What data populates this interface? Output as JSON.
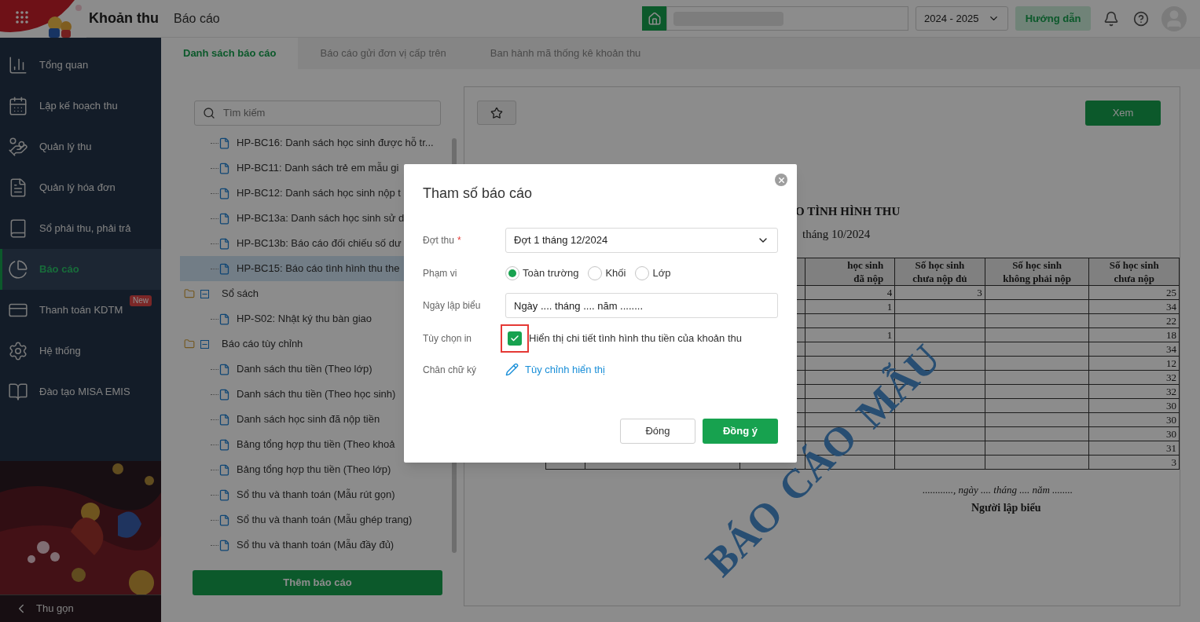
{
  "header": {
    "module": "Khoản thu",
    "page": "Báo cáo",
    "year": "2024 - 2025",
    "help_button": "Hướng dẫn"
  },
  "sidebar": {
    "items": [
      {
        "label": "Tổng quan",
        "selected": false
      },
      {
        "label": "Lập kế hoạch thu",
        "selected": false
      },
      {
        "label": "Quản lý thu",
        "selected": false
      },
      {
        "label": "Quản lý hóa đơn",
        "selected": false
      },
      {
        "label": "Sổ phải thu, phải trả",
        "selected": false
      },
      {
        "label": "Báo cáo",
        "selected": true
      },
      {
        "label": "Thanh toán KDTM",
        "selected": false,
        "badge": "New"
      },
      {
        "label": "Hệ thống",
        "selected": false
      },
      {
        "label": "Đào tạo MISA EMIS",
        "selected": false
      }
    ],
    "collapse": "Thu gọn"
  },
  "tabs": [
    {
      "label": "Danh sách báo cáo",
      "selected": true
    },
    {
      "label": "Báo cáo gửi đơn vị cấp trên",
      "selected": false
    },
    {
      "label": "Ban hành mã thống kê khoản thu",
      "selected": false
    }
  ],
  "search": {
    "placeholder": "Tìm kiếm"
  },
  "tree": {
    "items": [
      {
        "kind": "file",
        "label": "HP-BC16: Danh sách học sinh được hỗ tr...",
        "selected": false
      },
      {
        "kind": "file",
        "label": "HP-BC11: Danh sách trẻ em mẫu gi",
        "selected": false
      },
      {
        "kind": "file",
        "label": "HP-BC12: Danh sách học sinh nộp t",
        "selected": false
      },
      {
        "kind": "file",
        "label": "HP-BC13a: Danh sách học sinh sử d",
        "selected": false
      },
      {
        "kind": "file",
        "label": "HP-BC13b: Báo cáo đối chiếu số dư",
        "selected": false
      },
      {
        "kind": "file",
        "label": "HP-BC15: Báo cáo tình hình thu the",
        "selected": true
      },
      {
        "kind": "folder",
        "label": "Sổ sách",
        "expanded": true,
        "children": [
          {
            "label": "HP-S02: Nhật ký thu bàn giao",
            "selected": false
          }
        ]
      },
      {
        "kind": "folder",
        "label": "Báo cáo tùy chỉnh",
        "expanded": true,
        "children": [
          {
            "label": "Danh sách thu tiền (Theo lớp)",
            "selected": false
          },
          {
            "label": "Danh sách thu tiền (Theo học sinh)",
            "selected": false
          },
          {
            "label": "Danh sách học sinh đã nộp tiền",
            "selected": false
          },
          {
            "label": "Bảng tổng hợp thu tiền (Theo khoả",
            "selected": false
          },
          {
            "label": "Bảng tổng hợp thu tiền (Theo lớp)",
            "selected": false
          },
          {
            "label": "Sổ thu và thanh toán (Mẫu rút gọn)",
            "selected": false
          },
          {
            "label": "Sổ thu và thanh toán (Mẫu ghép trang)",
            "selected": false
          },
          {
            "label": "Sổ thu và thanh toán (Mẫu đầy đủ)",
            "selected": false
          }
        ]
      }
    ]
  },
  "add_button": "Thêm báo cáo",
  "view_button": "Xem",
  "report": {
    "title_fragment": "O TÌNH HÌNH THU",
    "period_fragment": "tháng 10/2024",
    "watermark": [
      "BÁO",
      "CÁO",
      "MẪU"
    ],
    "table": {
      "columns": {
        "column_4": "học sinh\nđã nộp",
        "column_5": "Số học sinh\nchưa nộp đủ",
        "column_6": "Số học sinh\nkhông phải nộp",
        "column_7": "Số học sinh\nchưa nộp"
      },
      "rows": [
        {
          "column_4": "4",
          "column_5": "3",
          "column_7": "25"
        },
        {
          "column_4": "1",
          "column_7": "34"
        },
        {
          "column_7": "22"
        },
        {
          "column_4": "1",
          "column_7": "18"
        },
        {
          "column_7": "34"
        },
        {
          "column_7": "12"
        },
        {
          "column_7": "32"
        },
        {
          "column_7": "32"
        },
        {
          "column_7": "30"
        },
        {
          "column_7": "30"
        },
        {
          "column_7": "30"
        },
        {
          "column_7": "31"
        },
        {
          "column_7": "3"
        }
      ]
    },
    "date_line": "............, ngày .... tháng .... năm ........",
    "signer": "Người lập biểu"
  },
  "dialog": {
    "title": "Tham số báo cáo",
    "fields": [
      {
        "kind": "select",
        "label": "Đợt thu",
        "required_mark": "*",
        "value": "Đợt 1 tháng 12/2024"
      },
      {
        "kind": "radio",
        "label": "Phạm vi",
        "options": [
          {
            "label": "Toàn trường",
            "selected": true
          },
          {
            "label": "Khối",
            "selected": false
          },
          {
            "label": "Lớp",
            "selected": false
          }
        ]
      },
      {
        "kind": "text",
        "label": "Ngày lập biểu",
        "value": "Ngày .... tháng .... năm ........"
      },
      {
        "kind": "checkbox",
        "label": "Tùy chọn in",
        "checked": true,
        "highlighted": true,
        "text": "Hiển thị chi tiết tình hình thu tiền của khoản thu"
      },
      {
        "kind": "link",
        "label": "Chân chữ ký",
        "text": "Tùy chỉnh hiển thị"
      }
    ],
    "buttons": [
      {
        "kind": "secondary",
        "label": "Đóng"
      },
      {
        "kind": "primary",
        "label": "Đồng ý"
      }
    ]
  }
}
